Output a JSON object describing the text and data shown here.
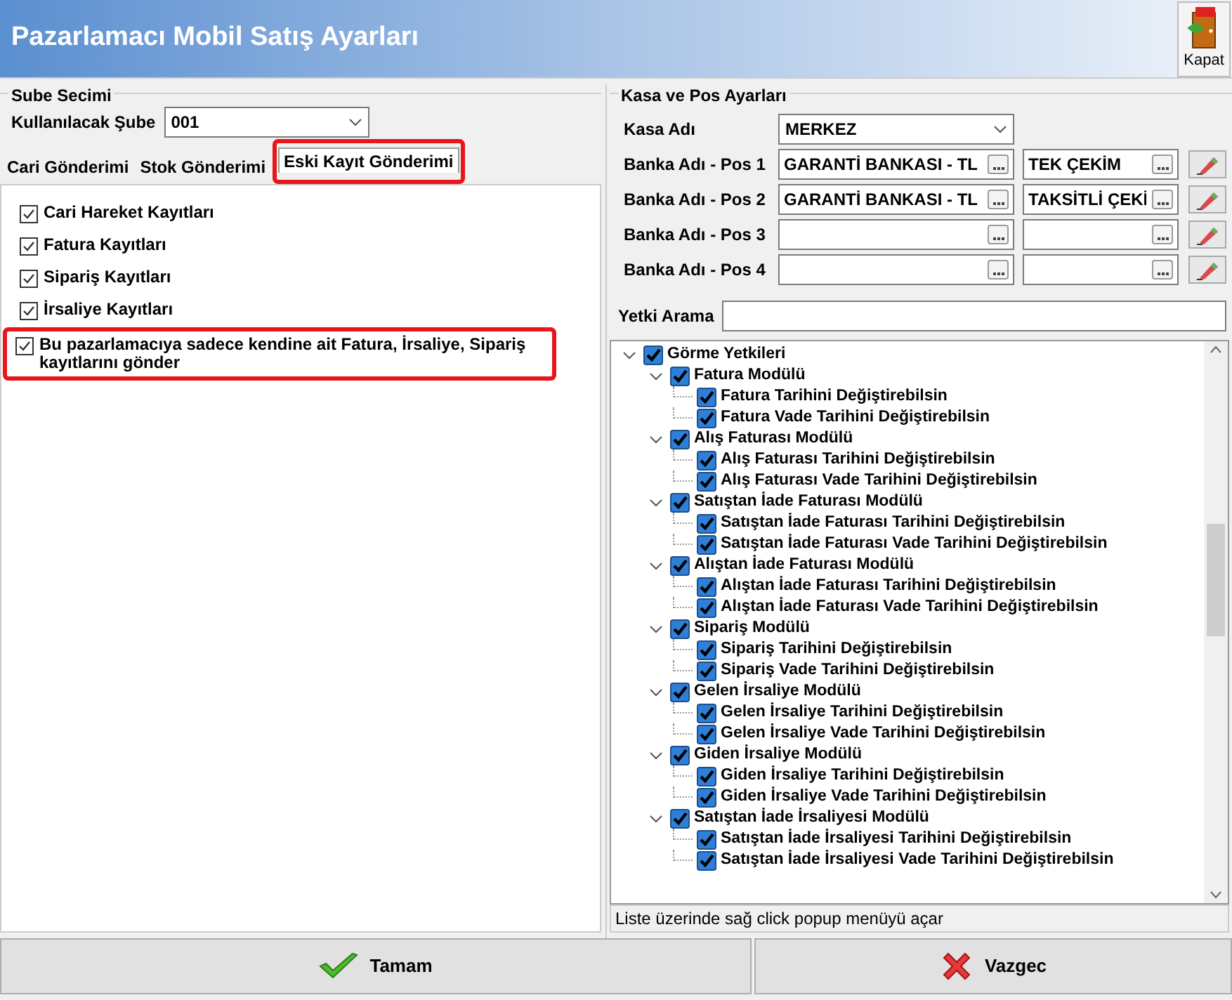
{
  "window": {
    "title": "Pazarlamacı Mobil Satış Ayarları",
    "close_button": "Kapat"
  },
  "branch": {
    "group_title": "Sube Secimi",
    "label": "Kullanılacak Şube",
    "value": "001"
  },
  "tabs": [
    {
      "label": "Cari Gönderimi",
      "selected": false,
      "highlighted": false
    },
    {
      "label": "Stok Gönderimi",
      "selected": false,
      "highlighted": false
    },
    {
      "label": "Eski Kayıt Gönderimi",
      "selected": true,
      "highlighted": true
    }
  ],
  "options": [
    {
      "label": "Cari Hareket Kayıtları",
      "checked": true,
      "highlighted": false
    },
    {
      "label": "Fatura Kayıtları",
      "checked": true,
      "highlighted": false
    },
    {
      "label": "Sipariş Kayıtları",
      "checked": true,
      "highlighted": false
    },
    {
      "label": "İrsaliye Kayıtları",
      "checked": true,
      "highlighted": false
    },
    {
      "label": "Bu pazarlamacıya sadece kendine ait Fatura, İrsaliye, Sipariş kayıtlarını gönder",
      "checked": true,
      "highlighted": true
    }
  ],
  "pos_settings": {
    "group_title": "Kasa ve Pos Ayarları",
    "cash_label": "Kasa Adı",
    "cash_value": "MERKEZ",
    "pos_rows": [
      {
        "label": "Banka Adı - Pos 1",
        "bank": "GARANTİ BANKASI - TL",
        "payment": "TEK ÇEKİM"
      },
      {
        "label": "Banka Adı - Pos 2",
        "bank": "GARANTİ BANKASI - TL",
        "payment": "TAKSİTLİ ÇEKİ"
      },
      {
        "label": "Banka Adı - Pos 3"
      },
      {
        "label": "Banka Adı - Pos 4"
      }
    ],
    "search_label": "Yetki Arama"
  },
  "tree": [
    {
      "label": "Görme Yetkileri",
      "checked": true,
      "expanded": true,
      "children": [
        {
          "label": "Fatura Modülü",
          "checked": true,
          "expanded": true,
          "children": [
            {
              "label": "Fatura Tarihini Değiştirebilsin",
              "checked": true
            },
            {
              "label": "Fatura Vade Tarihini Değiştirebilsin",
              "checked": true
            }
          ]
        },
        {
          "label": "Alış Faturası Modülü",
          "checked": true,
          "expanded": true,
          "children": [
            {
              "label": "Alış Faturası Tarihini Değiştirebilsin",
              "checked": true
            },
            {
              "label": "Alış Faturası Vade Tarihini Değiştirebilsin",
              "checked": true
            }
          ]
        },
        {
          "label": "Satıştan İade Faturası Modülü",
          "checked": true,
          "expanded": true,
          "children": [
            {
              "label": "Satıştan İade Faturası Tarihini Değiştirebilsin",
              "checked": true
            },
            {
              "label": "Satıştan İade Faturası Vade Tarihini Değiştirebilsin",
              "checked": true
            }
          ]
        },
        {
          "label": "Alıştan İade Faturası Modülü",
          "checked": true,
          "expanded": true,
          "children": [
            {
              "label": "Alıştan İade Faturası Tarihini Değiştirebilsin",
              "checked": true
            },
            {
              "label": "Alıştan İade Faturası Vade Tarihini Değiştirebilsin",
              "checked": true
            }
          ]
        },
        {
          "label": "Sipariş Modülü",
          "checked": true,
          "expanded": true,
          "children": [
            {
              "label": "Sipariş Tarihini Değiştirebilsin",
              "checked": true
            },
            {
              "label": "Sipariş Vade Tarihini Değiştirebilsin",
              "checked": true
            }
          ]
        },
        {
          "label": "Gelen İrsaliye Modülü",
          "checked": true,
          "expanded": true,
          "children": [
            {
              "label": "Gelen İrsaliye Tarihini Değiştirebilsin",
              "checked": true
            },
            {
              "label": "Gelen İrsaliye Vade Tarihini Değiştirebilsin",
              "checked": true
            }
          ]
        },
        {
          "label": "Giden İrsaliye Modülü",
          "checked": true,
          "expanded": true,
          "children": [
            {
              "label": "Giden İrsaliye Tarihini Değiştirebilsin",
              "checked": true
            },
            {
              "label": "Giden İrsaliye Vade Tarihini Değiştirebilsin",
              "checked": true
            }
          ]
        },
        {
          "label": "Satıştan İade İrsaliyesi Modülü",
          "checked": true,
          "expanded": true,
          "children": [
            {
              "label": "Satıştan İade İrsaliyesi Tarihini Değiştirebilsin",
              "checked": true
            },
            {
              "label": "Satıştan İade İrsaliyesi Vade Tarihini Değiştirebilsin",
              "checked": true
            }
          ]
        }
      ]
    }
  ],
  "hint": "Liste üzerinde sağ click popup menüyü açar",
  "buttons": [
    {
      "label": "Tamam",
      "kind": "ok"
    },
    {
      "label": "Vazgec",
      "kind": "cancel"
    }
  ]
}
